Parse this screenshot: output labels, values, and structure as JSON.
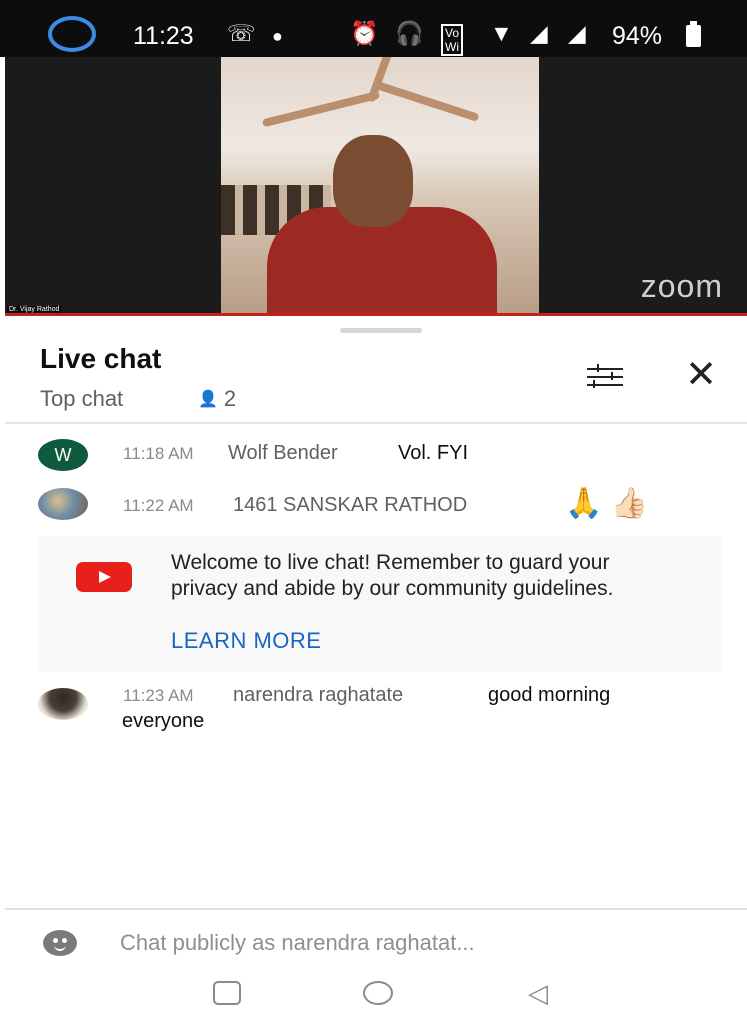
{
  "status_bar": {
    "time": "11:23",
    "battery_percent": "94%",
    "icons": [
      "assistant-ring-icon",
      "missed-call-icon",
      "dot-icon",
      "alarm-icon",
      "headphones-icon",
      "vowifi-icon",
      "wifi-icon",
      "signal-icon",
      "signal-icon",
      "battery-icon"
    ]
  },
  "video": {
    "participant_name": "Dr. Vijay Rathod",
    "watermark": "zoom",
    "border_color": "#c0231f"
  },
  "chat": {
    "title": "Live chat",
    "mode": "Top chat",
    "viewer_count": "2",
    "messages": [
      {
        "avatar_letter": "W",
        "time": "11:18 AM",
        "author": "Wolf Bender",
        "text": "Vol. FYI"
      },
      {
        "avatar_letter": "",
        "time": "11:22 AM",
        "author": "1461 SANSKAR RATHOD",
        "text": "🙏 👍🏻"
      },
      {
        "avatar_letter": "",
        "time": "11:23 AM",
        "author": "narendra raghatate",
        "text": "good morning",
        "text_cont": "everyone"
      }
    ],
    "welcome": {
      "text": "Welcome to live chat! Remember to guard your privacy and abide by our community guidelines.",
      "link": "LEARN MORE"
    },
    "input_placeholder": "Chat publicly as narendra raghatat..."
  },
  "colors": {
    "accent_link": "#1666c5",
    "youtube_red": "#e8201c",
    "avatar_w": "#0f5a3d"
  }
}
